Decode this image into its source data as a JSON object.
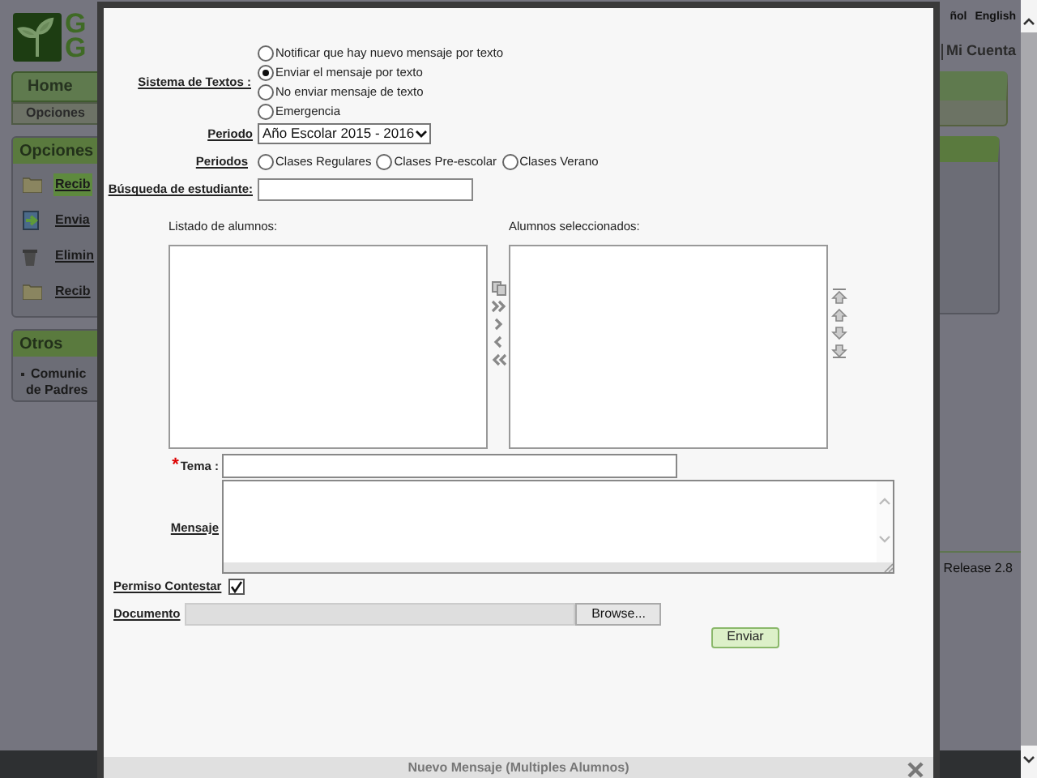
{
  "background_page": {
    "logo_letters": [
      "G",
      "G"
    ],
    "language_links": [
      "ñol",
      "English"
    ],
    "account_link": "Mi Cuenta",
    "nav_tabs": [
      {
        "label": "Home"
      }
    ],
    "sub_nav": "Opciones",
    "panels": [
      {
        "title": "Opciones",
        "items": [
          {
            "label": "Recib",
            "kind": "folder",
            "selected": true
          },
          {
            "label": "Envia",
            "kind": "sent",
            "selected": false
          },
          {
            "label": "Elimin",
            "kind": "trash",
            "selected": false
          },
          {
            "label": "Recib",
            "kind": "folder",
            "selected": false
          }
        ]
      },
      {
        "title": "Otros",
        "items": [
          {
            "label": "Comunic",
            "kind": "bullet",
            "selected": false
          },
          {
            "label": "de Padres",
            "kind": "continued",
            "selected": false
          }
        ]
      }
    ],
    "release": "Release 2.8"
  },
  "dialog": {
    "title": "Nuevo Mensaje (Multiples Alumnos)",
    "text_system": {
      "label": "Sistema de Textos :",
      "options": [
        {
          "label": "Notificar que hay nuevo mensaje por texto",
          "selected": false
        },
        {
          "label": "Enviar el mensaje por texto",
          "selected": true
        },
        {
          "label": "No enviar mensaje de texto",
          "selected": false
        },
        {
          "label": "Emergencia",
          "selected": false
        }
      ]
    },
    "period": {
      "label": "Periodo",
      "value": "Año Escolar 2015 - 2016"
    },
    "periods": {
      "label": "Periodos",
      "options": [
        {
          "label": "Clases Regulares",
          "selected": false
        },
        {
          "label": "Clases Pre-escolar",
          "selected": false
        },
        {
          "label": "Clases Verano",
          "selected": false
        }
      ]
    },
    "student_search": {
      "label": "Búsqueda de estudiante:"
    },
    "student_list": {
      "label": "Listado de alumnos:"
    },
    "selected_list": {
      "label": "Alumnos seleccionados:"
    },
    "subject": {
      "label": "Tema :",
      "required_mark": "*"
    },
    "message": {
      "label": "Mensaje"
    },
    "allow_reply": {
      "label": "Permiso Contestar",
      "checked": true
    },
    "document": {
      "label": "Documento",
      "button": "Browse..."
    },
    "submit": "Enviar"
  }
}
